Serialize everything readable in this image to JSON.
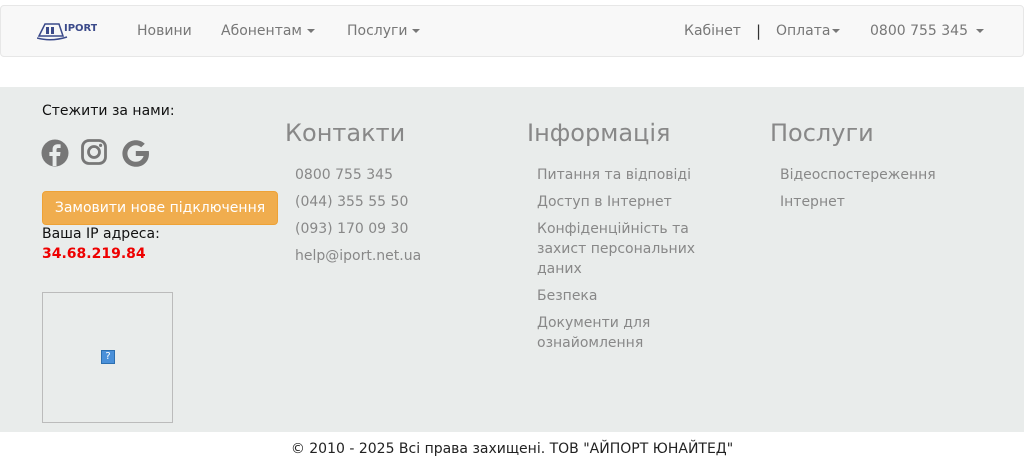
{
  "navbar": {
    "logo_text": "IPORT",
    "items": [
      {
        "label": "Новини"
      },
      {
        "label": "Абонентам"
      },
      {
        "label": "Послуги"
      }
    ],
    "cabinet": "Кабінет",
    "separator": "|",
    "payment": "Оплата",
    "phone": "0800 755 345"
  },
  "footer": {
    "follow_title": "Стежити за нами:",
    "social_icons": [
      "facebook-icon",
      "instagram-icon",
      "google-icon"
    ],
    "order_button": "Замовити нове підключення",
    "ip_label": "Ваша IP адреса:",
    "ip_value": "34.68.219.84",
    "ip_color": "#e00000",
    "button_color": "#f0ad4e",
    "contacts": {
      "title": "Контакти",
      "items": [
        "0800 755 345",
        "(044) 355 55 50",
        "(093) 170 09 30",
        "help@iport.net.ua"
      ]
    },
    "info": {
      "title": "Інформація",
      "items": [
        "Питання та відповіді",
        "Доступ в Інтернет",
        "Конфіденційність та захист персональних даних",
        "Безпека",
        "Документи для ознайомлення"
      ]
    },
    "services": {
      "title": "Послуги",
      "items": [
        "Відеоспостереження",
        "Інтернет"
      ]
    }
  },
  "copyright": "© 2010 - 2025 Всі права захищені. ТОВ \"АЙПОРТ ЮНАЙТЕД\""
}
